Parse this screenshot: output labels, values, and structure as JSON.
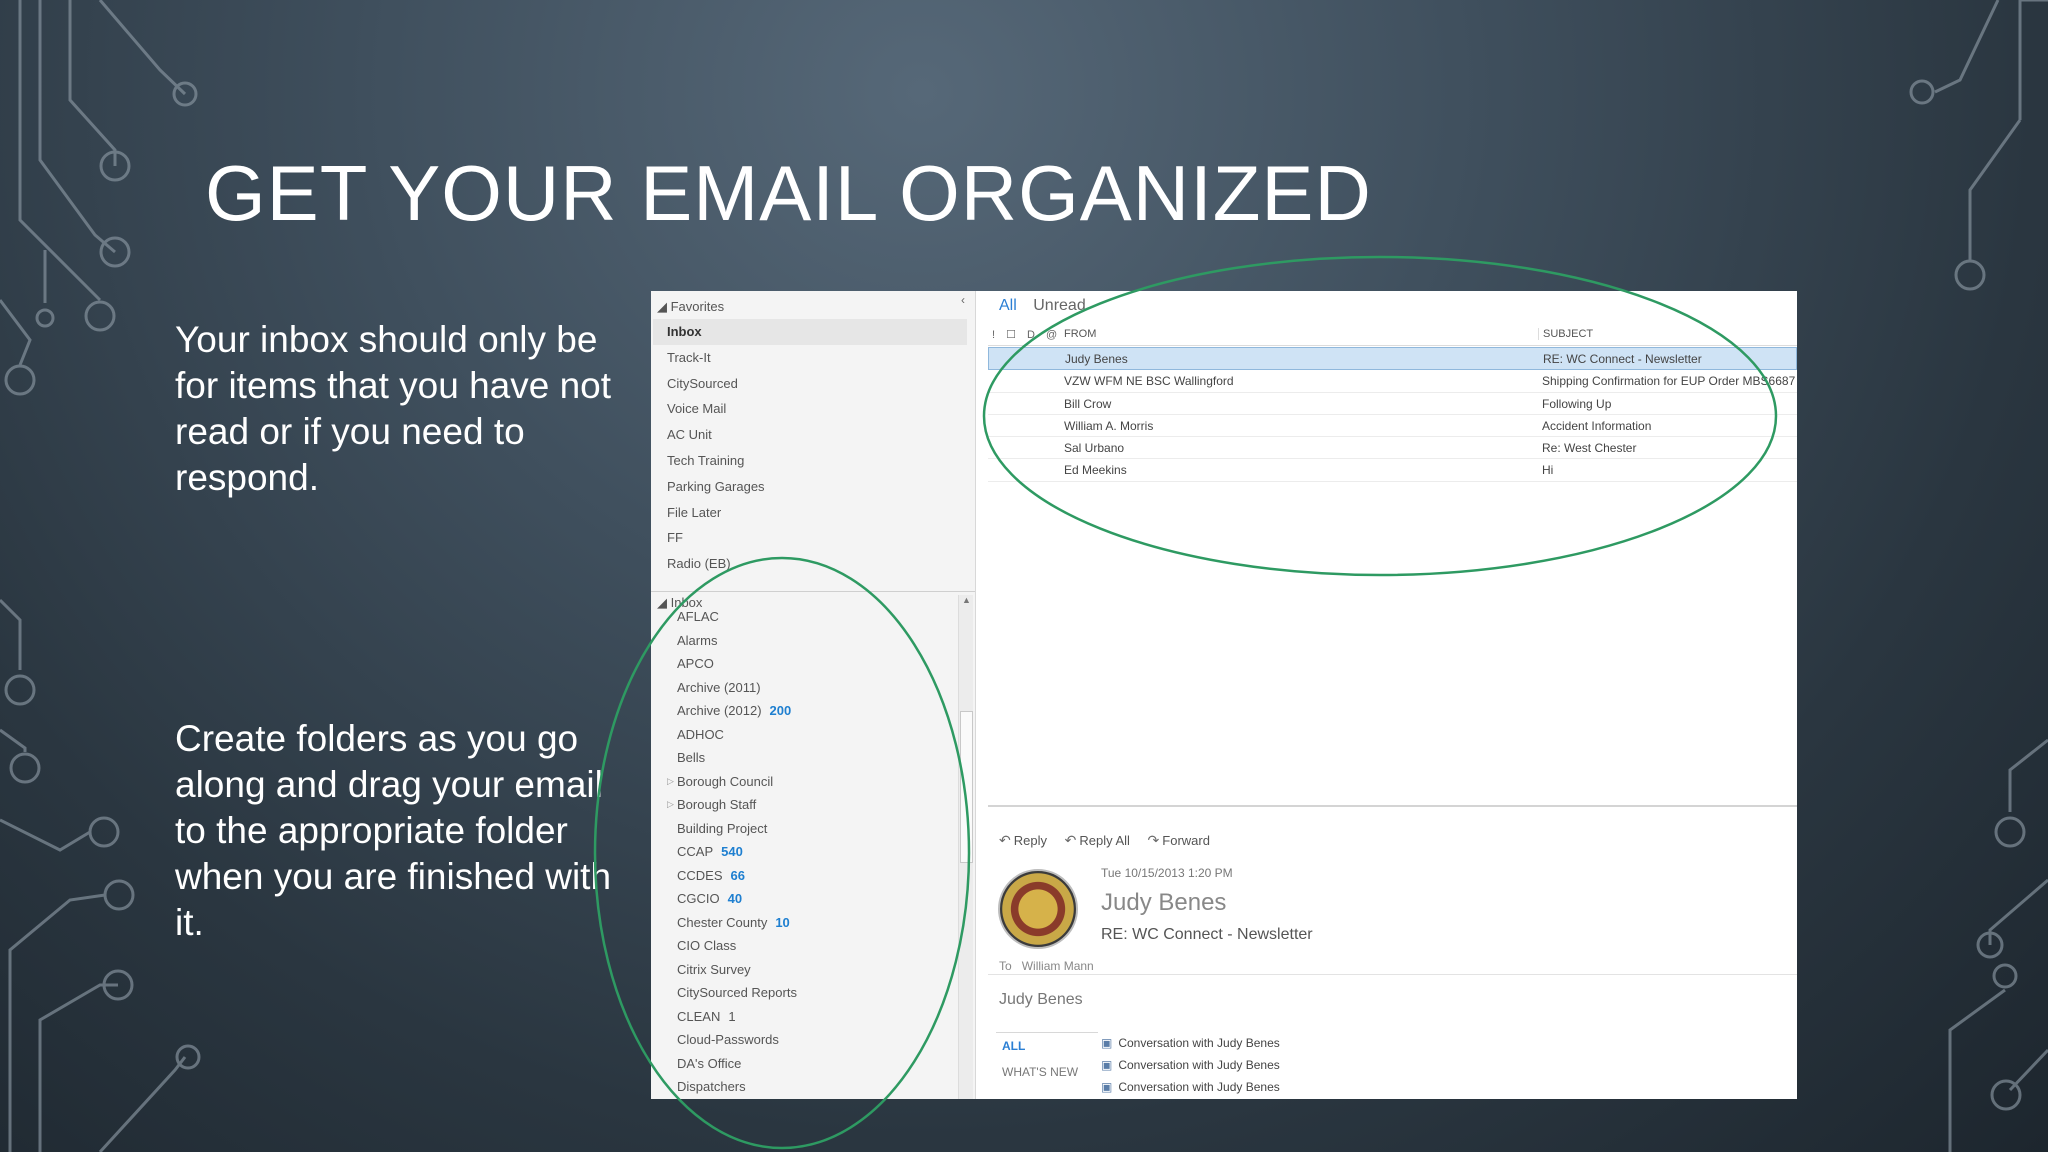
{
  "slide": {
    "title": "GET YOUR EMAIL ORGANIZED",
    "paragraphs": [
      "Your inbox should only be for items that you have not read or if you need to respond.",
      "Create folders as you go along and drag your email to the appropriate folder when you are finished with it."
    ]
  },
  "outlook": {
    "favorites_header": "Favorites",
    "favorites": [
      "Inbox",
      "Track-It",
      "CitySourced",
      "Voice Mail",
      "AC Unit",
      "Tech Training",
      "Parking Garages",
      "File Later",
      "FF",
      "Radio (EB)"
    ],
    "inbox_header": "Inbox",
    "folders": [
      {
        "name": "AFLAC",
        "count": ""
      },
      {
        "name": "Alarms",
        "count": ""
      },
      {
        "name": "APCO",
        "count": ""
      },
      {
        "name": "Archive (2011)",
        "count": ""
      },
      {
        "name": "Archive (2012)",
        "count": "200"
      },
      {
        "name": "ADHOC",
        "count": ""
      },
      {
        "name": "Bells",
        "count": ""
      },
      {
        "name": "Borough Council",
        "count": ""
      },
      {
        "name": "Borough Staff",
        "count": ""
      },
      {
        "name": "Building Project",
        "count": ""
      },
      {
        "name": "CCAP",
        "count": "540"
      },
      {
        "name": "CCDES",
        "count": "66"
      },
      {
        "name": "CGCIO",
        "count": "40"
      },
      {
        "name": "Chester County",
        "count": "10"
      },
      {
        "name": "CIO Class",
        "count": ""
      },
      {
        "name": "Citrix Survey",
        "count": ""
      },
      {
        "name": "CitySourced Reports",
        "count": ""
      },
      {
        "name": "CLEAN",
        "count": "1"
      },
      {
        "name": "Cloud-Passwords",
        "count": ""
      },
      {
        "name": "DA's Office",
        "count": ""
      },
      {
        "name": "Dispatchers",
        "count": ""
      }
    ],
    "filters": {
      "all": "All",
      "unread": "Unread"
    },
    "columns": {
      "icons": "! ☐ D @",
      "from": "FROM",
      "subject": "SUBJECT"
    },
    "messages": [
      {
        "from": "Judy Benes",
        "subject": "RE: WC Connect - Newsletter"
      },
      {
        "from": "VZW WFM NE BSC Wallingford",
        "subject": "Shipping Confirmation for EUP Order MBS6687"
      },
      {
        "from": "Bill Crow",
        "subject": "Following Up"
      },
      {
        "from": "William A. Morris",
        "subject": "Accident Information"
      },
      {
        "from": "Sal Urbano",
        "subject": "Re: West Chester"
      },
      {
        "from": "Ed Meekins",
        "subject": "Hi"
      }
    ],
    "reading": {
      "actions": {
        "reply": "Reply",
        "reply_all": "Reply All",
        "forward": "Forward"
      },
      "date": "Tue 10/15/2013 1:20 PM",
      "sender": "Judy Benes",
      "subject": "RE: WC Connect - Newsletter",
      "to_label": "To",
      "to": "William Mann",
      "body_name": "Judy Benes",
      "tabs": [
        "ALL",
        "WHAT'S NEW"
      ],
      "conversations": [
        "Conversation with Judy Benes",
        "Conversation with Judy Benes",
        "Conversation with Judy Benes"
      ]
    }
  },
  "colors": {
    "annotation_ring": "#2e9a62",
    "accent_blue": "#2b7fd4",
    "selection": "#cfe3f5"
  }
}
